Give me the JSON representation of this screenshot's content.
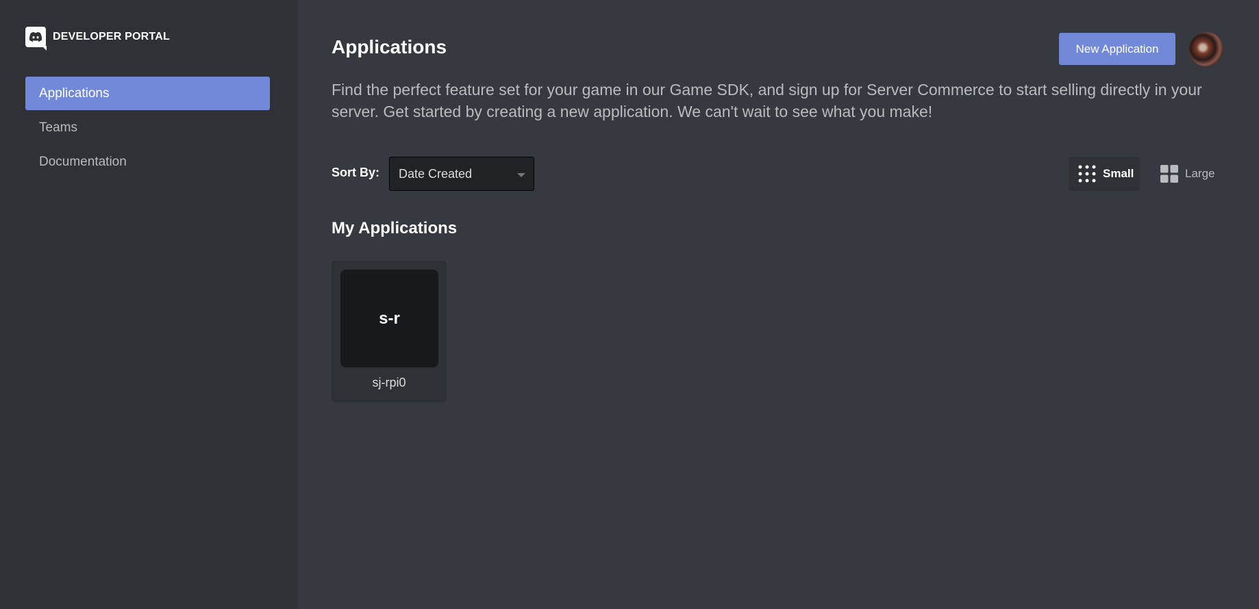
{
  "sidebar": {
    "brand": "DEVELOPER PORTAL",
    "items": [
      {
        "label": "Applications"
      },
      {
        "label": "Teams"
      },
      {
        "label": "Documentation"
      }
    ]
  },
  "header": {
    "title": "Applications",
    "new_button_label": "New Application",
    "description": "Find the perfect feature set for your game in our Game SDK, and sign up for Server Commerce to start selling directly in your server. Get started by creating a new application. We can't wait to see what you make!"
  },
  "toolbar": {
    "sort_label": "Sort By:",
    "sort_value": "Date Created",
    "view_small_label": "Small",
    "view_large_label": "Large"
  },
  "applications": {
    "section_title": "My Applications",
    "items": [
      {
        "initials": "s-r",
        "name": "sj-rpi0"
      }
    ]
  },
  "colors": {
    "accent": "#7289da",
    "sidebar_bg": "#2f3136",
    "main_bg": "#36393f"
  }
}
